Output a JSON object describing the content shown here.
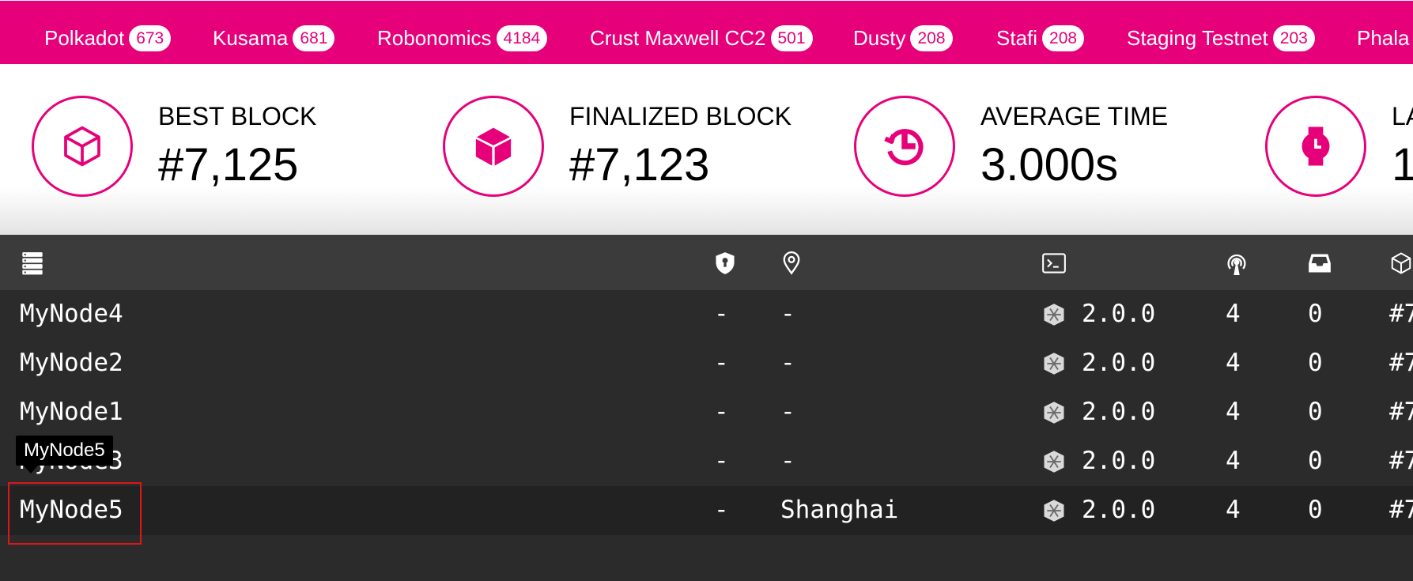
{
  "chains": [
    {
      "name": "Polkadot",
      "count": "673"
    },
    {
      "name": "Kusama",
      "count": "681"
    },
    {
      "name": "Robonomics",
      "count": "4184"
    },
    {
      "name": "Crust Maxwell CC2",
      "count": "501"
    },
    {
      "name": "Dusty",
      "count": "208"
    },
    {
      "name": "Stafi",
      "count": "208"
    },
    {
      "name": "Staging Testnet",
      "count": "203"
    },
    {
      "name": "Phala",
      "count": ""
    }
  ],
  "stats": [
    {
      "label": "BEST BLOCK",
      "value": "#7,125",
      "icon": "cube-outline-icon"
    },
    {
      "label": "FINALIZED BLOCK",
      "value": "#7,123",
      "icon": "cube-solid-icon"
    },
    {
      "label": "AVERAGE TIME",
      "value": "3.000s",
      "icon": "history-clock-icon"
    },
    {
      "label": "LA",
      "value": "1",
      "icon": "watch-icon"
    }
  ],
  "columns": [
    {
      "name": "node-name",
      "icon": "server-stack-icon"
    },
    {
      "name": "validator",
      "icon": "shield-keyhole-icon"
    },
    {
      "name": "location",
      "icon": "map-pin-icon"
    },
    {
      "name": "implementation",
      "icon": "terminal-icon"
    },
    {
      "name": "peers",
      "icon": "broadcast-icon"
    },
    {
      "name": "transactions",
      "icon": "inbox-icon"
    },
    {
      "name": "block",
      "icon": "cube-outline-icon"
    }
  ],
  "nodes": [
    {
      "name": "MyNode4",
      "validator": "-",
      "location": "-",
      "version": "2.0.0",
      "peers": "4",
      "txs": "0",
      "block": "#7"
    },
    {
      "name": "MyNode2",
      "validator": "-",
      "location": "-",
      "version": "2.0.0",
      "peers": "4",
      "txs": "0",
      "block": "#7"
    },
    {
      "name": "MyNode1",
      "validator": "-",
      "location": "-",
      "version": "2.0.0",
      "peers": "4",
      "txs": "0",
      "block": "#7"
    },
    {
      "name": "MyNode3",
      "validator": "-",
      "location": "-",
      "version": "2.0.0",
      "peers": "4",
      "txs": "0",
      "block": "#7"
    },
    {
      "name": "MyNode5",
      "validator": "-",
      "location": "Shanghai",
      "version": "2.0.0",
      "peers": "4",
      "txs": "0",
      "block": "#7"
    }
  ],
  "tooltip": {
    "text": "MyNode5"
  },
  "colors": {
    "accent": "#e6007a",
    "table_bg": "#2b2b2b",
    "header_bg": "#3b3b3b",
    "selection": "#e0151a"
  }
}
